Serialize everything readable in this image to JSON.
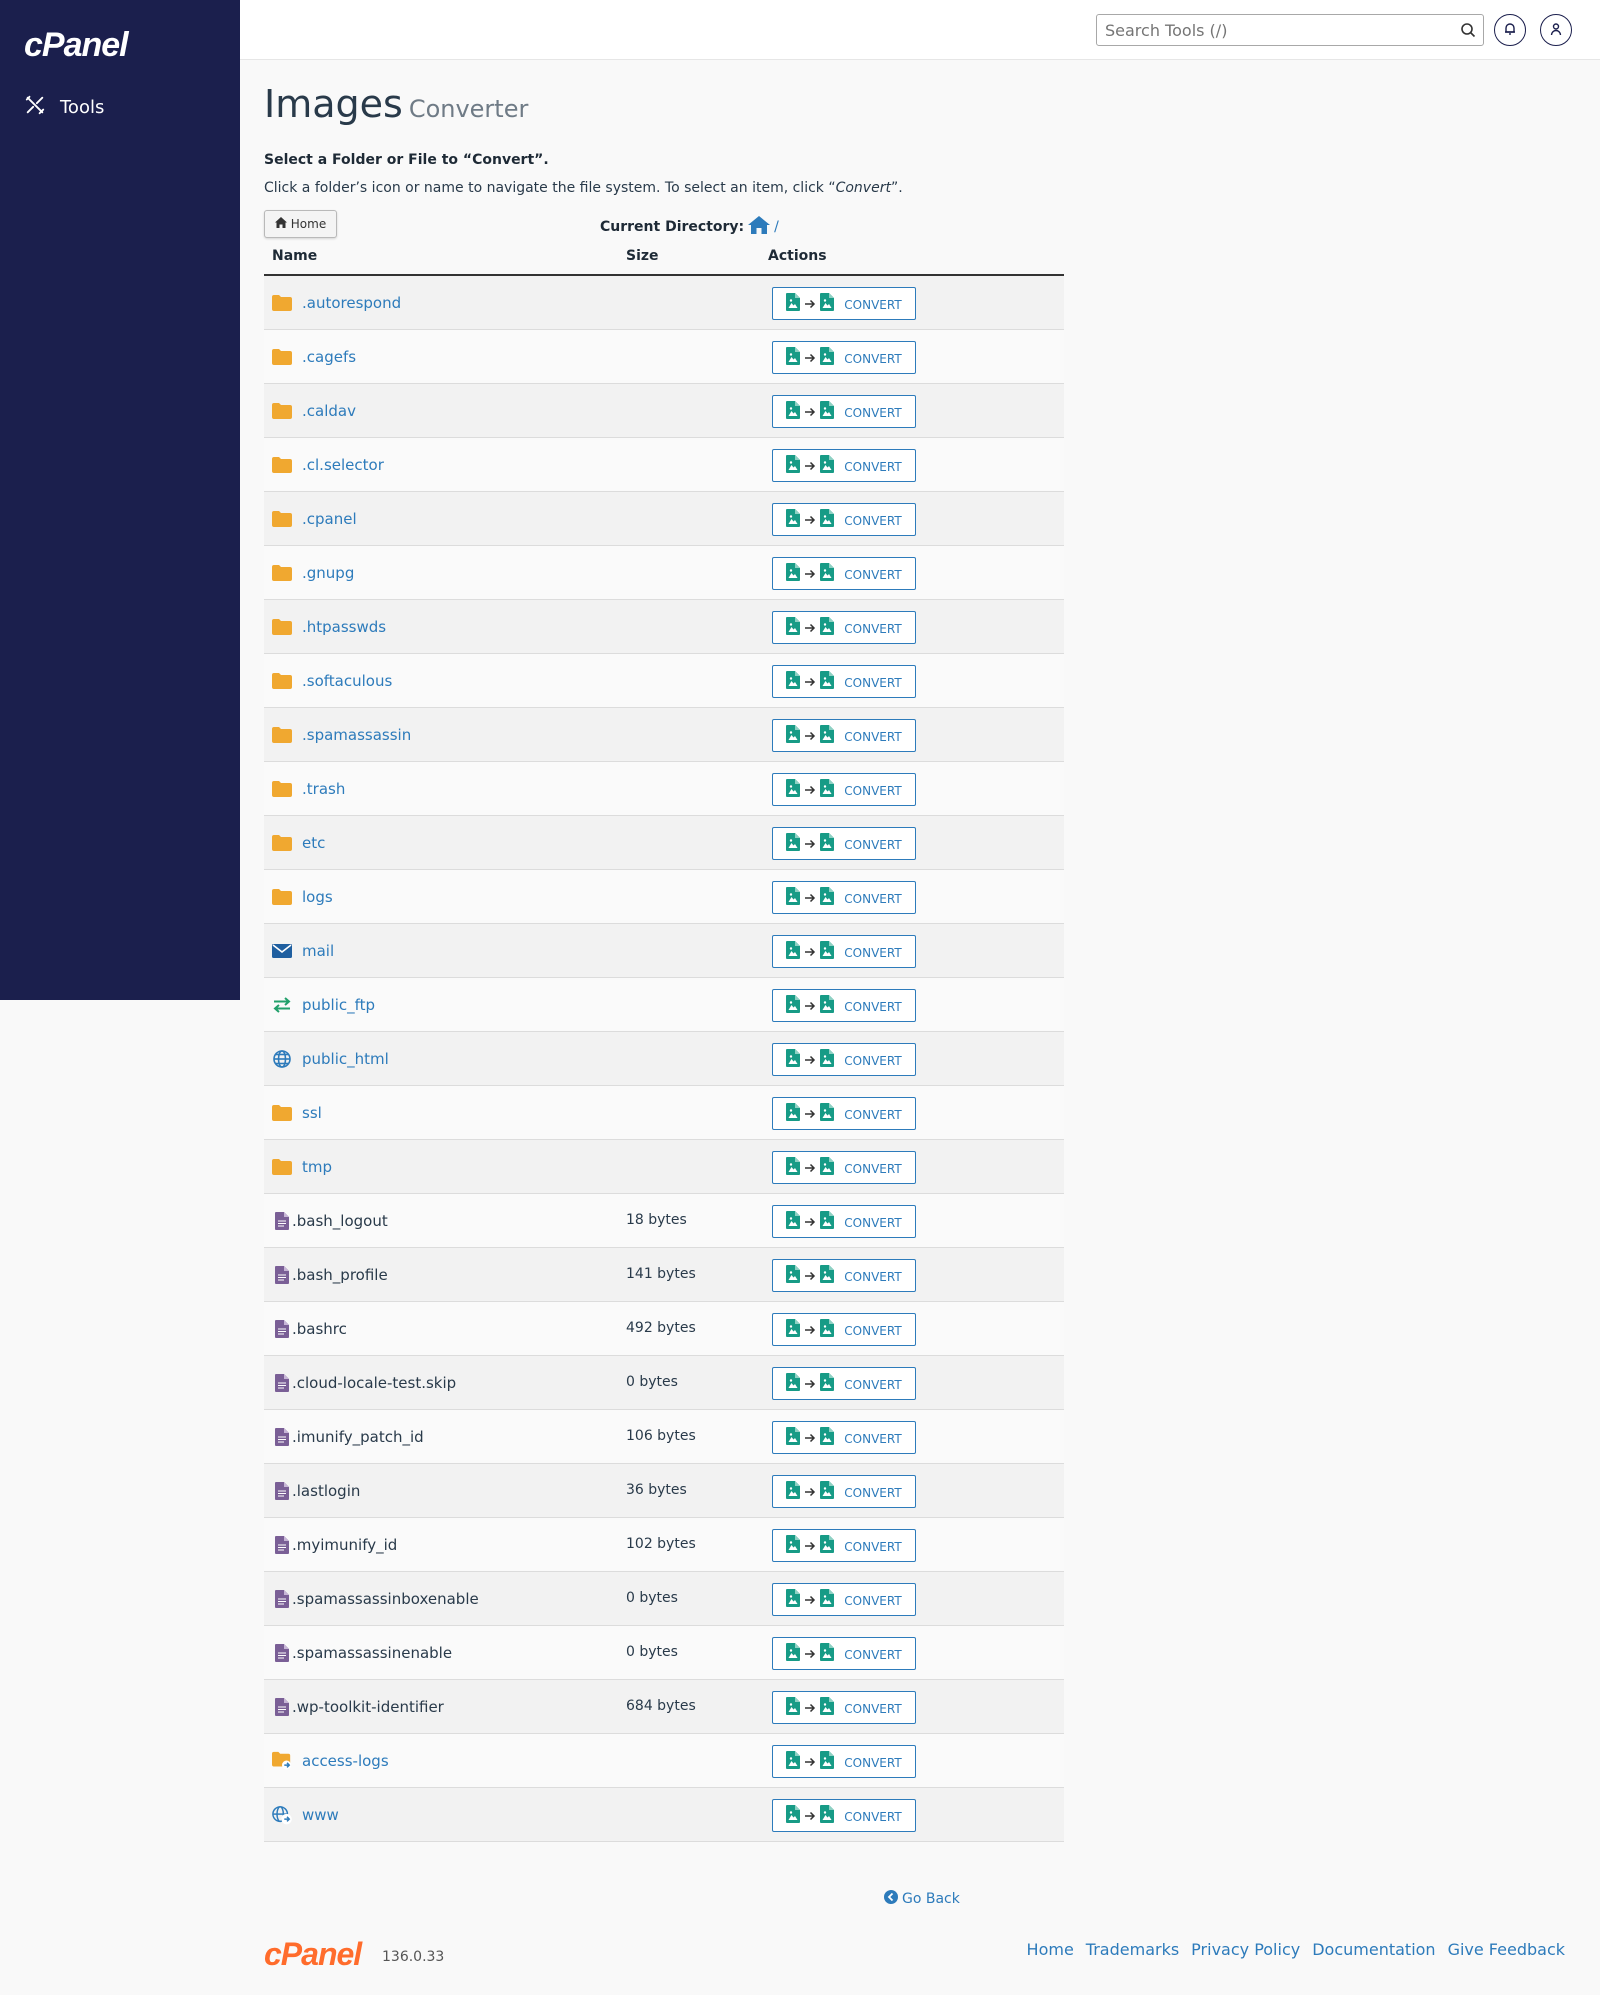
{
  "sidebar": {
    "brand": "cPanel",
    "tools_label": "Tools"
  },
  "header": {
    "search_placeholder": "Search Tools (/)"
  },
  "page": {
    "title": "Images",
    "subtitle": "Converter",
    "instruction_title": "Select a Folder or File to “Convert”.",
    "instruction_body": "Click a folder’s icon or name to navigate the file system. To select an item, click “",
    "instruction_em": "Convert",
    "instruction_end": "”.",
    "home_button": "Home",
    "current_directory_label": "Current Directory:",
    "current_directory_path": "/"
  },
  "table": {
    "columns": {
      "name": "Name",
      "size": "Size",
      "actions": "Actions"
    },
    "convert_label": "CONVERT",
    "rows": [
      {
        "name": ".autorespond",
        "size": "",
        "type": "folder",
        "icon": "folder-icon"
      },
      {
        "name": ".cagefs",
        "size": "",
        "type": "folder",
        "icon": "folder-icon"
      },
      {
        "name": ".caldav",
        "size": "",
        "type": "folder",
        "icon": "folder-icon"
      },
      {
        "name": ".cl.selector",
        "size": "",
        "type": "folder",
        "icon": "folder-icon"
      },
      {
        "name": ".cpanel",
        "size": "",
        "type": "folder",
        "icon": "folder-icon"
      },
      {
        "name": ".gnupg",
        "size": "",
        "type": "folder",
        "icon": "folder-icon"
      },
      {
        "name": ".htpasswds",
        "size": "",
        "type": "folder",
        "icon": "folder-icon"
      },
      {
        "name": ".softaculous",
        "size": "",
        "type": "folder",
        "icon": "folder-icon"
      },
      {
        "name": ".spamassassin",
        "size": "",
        "type": "folder",
        "icon": "folder-icon"
      },
      {
        "name": ".trash",
        "size": "",
        "type": "folder",
        "icon": "folder-icon"
      },
      {
        "name": "etc",
        "size": "",
        "type": "folder",
        "icon": "folder-icon"
      },
      {
        "name": "logs",
        "size": "",
        "type": "folder",
        "icon": "folder-icon"
      },
      {
        "name": "mail",
        "size": "",
        "type": "mail",
        "icon": "mail-icon"
      },
      {
        "name": "public_ftp",
        "size": "",
        "type": "ftp",
        "icon": "transfer-icon"
      },
      {
        "name": "public_html",
        "size": "",
        "type": "globe",
        "icon": "globe-icon"
      },
      {
        "name": "ssl",
        "size": "",
        "type": "folder",
        "icon": "folder-icon"
      },
      {
        "name": "tmp",
        "size": "",
        "type": "folder",
        "icon": "folder-icon"
      },
      {
        "name": ".bash_logout",
        "size": "18 bytes",
        "type": "file",
        "icon": "file-icon"
      },
      {
        "name": ".bash_profile",
        "size": "141 bytes",
        "type": "file",
        "icon": "file-icon"
      },
      {
        "name": ".bashrc",
        "size": "492 bytes",
        "type": "file",
        "icon": "file-icon"
      },
      {
        "name": ".cloud-locale-test.skip",
        "size": "0 bytes",
        "type": "file",
        "icon": "file-icon"
      },
      {
        "name": ".imunify_patch_id",
        "size": "106 bytes",
        "type": "file",
        "icon": "file-icon"
      },
      {
        "name": ".lastlogin",
        "size": "36 bytes",
        "type": "file",
        "icon": "file-icon"
      },
      {
        "name": ".myimunify_id",
        "size": "102 bytes",
        "type": "file",
        "icon": "file-icon"
      },
      {
        "name": ".spamassassinboxenable",
        "size": "0 bytes",
        "type": "file",
        "icon": "file-icon"
      },
      {
        "name": ".spamassassinenable",
        "size": "0 bytes",
        "type": "file",
        "icon": "file-icon"
      },
      {
        "name": ".wp-toolkit-identifier",
        "size": "684 bytes",
        "type": "file",
        "icon": "file-icon"
      },
      {
        "name": "access-logs",
        "size": "",
        "type": "folder-link",
        "icon": "folder-link-icon"
      },
      {
        "name": "www",
        "size": "",
        "type": "globe-link",
        "icon": "globe-link-icon"
      }
    ]
  },
  "footer": {
    "go_back": "Go Back",
    "brand": "cPanel",
    "version": "136.0.33",
    "links": [
      "Home",
      "Trademarks",
      "Privacy Policy",
      "Documentation",
      "Give Feedback"
    ]
  },
  "colors": {
    "sidebar_bg": "#1b1f4d",
    "link": "#2d7bbb",
    "folder": "#f0a830",
    "file": "#7a5f96",
    "convert_icon": "#179b86",
    "brand_orange": "#ff6c2c"
  }
}
